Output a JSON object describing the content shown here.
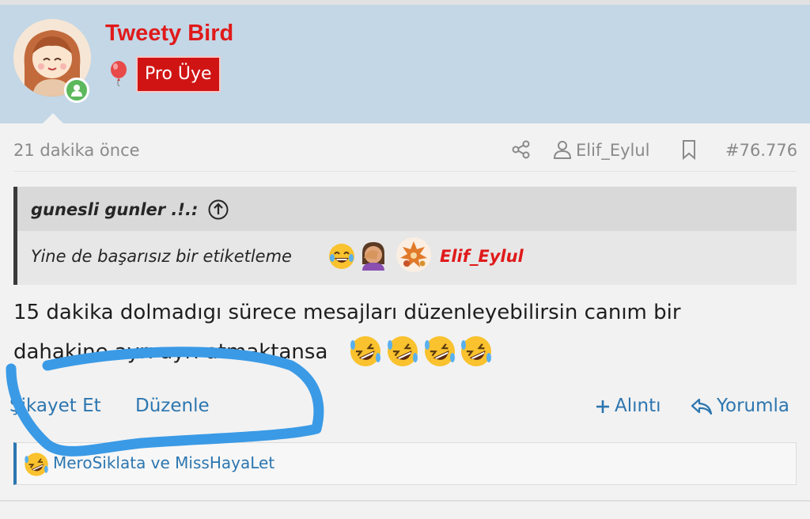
{
  "user": {
    "name": "Tweety Bird",
    "badge": "Pro Üye"
  },
  "meta": {
    "time": "21 dakika önce",
    "author": "Elif_Eylul",
    "post_number": "#76.776"
  },
  "quote": {
    "author": "gunesli gunler .!.:",
    "text": "Yine de başarısız bir etiketleme",
    "mention": "Elif_Eylul"
  },
  "body": {
    "line1": "15 dakika dolmadıgı sürece mesajları düzenleyebilirsin canım bir",
    "line2": "dahakine ayrı ayrı atmaktansa"
  },
  "actions": {
    "report": "Şikayet Et",
    "edit": "Düzenle",
    "quote": "Alıntı",
    "reply": "Yorumla"
  },
  "reactions": {
    "text": "MeroSiklata ve MissHayaLet"
  },
  "colors": {
    "header_bg": "#c3d7e6",
    "username": "#e01a1a",
    "badge_bg": "#d01414",
    "link": "#2c76b0",
    "annotation": "#3a9ae6"
  },
  "icons": {
    "share": "share-icon",
    "user": "user-icon",
    "bookmark": "bookmark-icon",
    "quote_jump": "arrow-up-circle-icon",
    "plus": "plus-icon",
    "reply": "reply-arrow-icon"
  }
}
